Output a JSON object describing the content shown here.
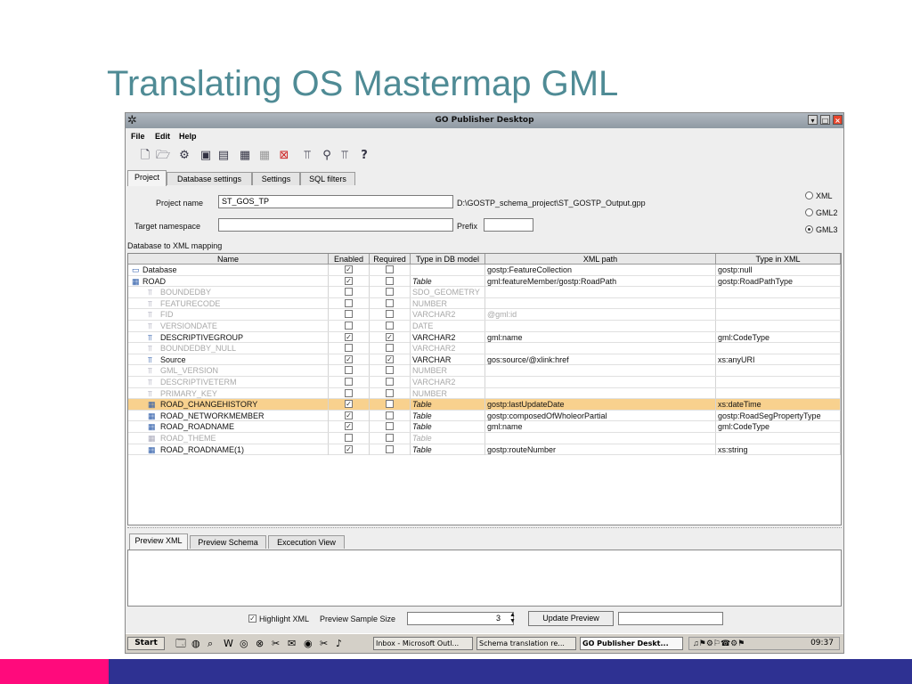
{
  "slide": {
    "title": "Translating OS Mastermap GML"
  },
  "window": {
    "title": "GO Publisher Desktop",
    "app_icon": "gear-star-icon"
  },
  "menu": {
    "file": "File",
    "edit": "Edit",
    "help": "Help"
  },
  "toolbar_icons": [
    "new-document-icon",
    "open-folder-icon",
    "gear-icon",
    "save-icon",
    "save-all-icon",
    "table-icon",
    "grey-table-icon",
    "delete-table-icon",
    "mapping-icon",
    "schema-icon",
    "mapping-wizard-icon",
    "help-icon"
  ],
  "tabs": [
    "Project",
    "Database settings",
    "Settings",
    "SQL filters"
  ],
  "project": {
    "name_label": "Project name",
    "name_value": "ST_GOS_TP",
    "path": "D:\\GOSTP_schema_project\\ST_GOSTP_Output.gpp",
    "namespace_label": "Target namespace",
    "namespace_value": "",
    "prefix_label": "Prefix",
    "prefix_value": "",
    "formats": [
      "XML",
      "GML2",
      "GML3"
    ],
    "selected_format": "GML3"
  },
  "mapping": {
    "label": "Database to XML mapping",
    "columns": [
      "Name",
      "Enabled",
      "Required",
      "Type in DB model",
      "XML path",
      "Type in XML"
    ],
    "rows": [
      {
        "name": "Database",
        "enabled": true,
        "required": false,
        "dbtype": "",
        "xmlpath": "gostp:FeatureCollection",
        "xmltype": "gostp:null",
        "level": 0,
        "dim": false
      },
      {
        "name": "ROAD",
        "enabled": true,
        "required": false,
        "dbtype": "Table",
        "xmlpath": "gml:featureMember/gostp:RoadPath",
        "xmltype": "gostp:RoadPathType",
        "level": 0,
        "dim": false
      },
      {
        "name": "BOUNDEDBY",
        "enabled": false,
        "required": false,
        "dbtype": "SDO_GEOMETRY",
        "xmlpath": "",
        "xmltype": "",
        "level": 1,
        "dim": true
      },
      {
        "name": "FEATURECODE",
        "enabled": false,
        "required": false,
        "dbtype": "NUMBER",
        "xmlpath": "",
        "xmltype": "",
        "level": 1,
        "dim": true
      },
      {
        "name": "FID",
        "enabled": false,
        "required": false,
        "dbtype": "VARCHAR2",
        "xmlpath": "@gml:id",
        "xmltype": "",
        "level": 1,
        "dim": true
      },
      {
        "name": "VERSIONDATE",
        "enabled": false,
        "required": false,
        "dbtype": "DATE",
        "xmlpath": "",
        "xmltype": "",
        "level": 1,
        "dim": true
      },
      {
        "name": "DESCRIPTIVEGROUP",
        "enabled": true,
        "required": true,
        "dbtype": "VARCHAR2",
        "xmlpath": "gml:name",
        "xmltype": "gml:CodeType",
        "level": 1,
        "dim": false
      },
      {
        "name": "BOUNDEDBY_NULL",
        "enabled": false,
        "required": false,
        "dbtype": "VARCHAR2",
        "xmlpath": "",
        "xmltype": "",
        "level": 1,
        "dim": true
      },
      {
        "name": "Source",
        "enabled": true,
        "required": true,
        "dbtype": "VARCHAR",
        "xmlpath": "gos:source/@xlink:href",
        "xmltype": "xs:anyURI",
        "level": 1,
        "dim": false
      },
      {
        "name": "GML_VERSION",
        "enabled": false,
        "required": false,
        "dbtype": "NUMBER",
        "xmlpath": "",
        "xmltype": "",
        "level": 1,
        "dim": true
      },
      {
        "name": "DESCRIPTIVETERM",
        "enabled": false,
        "required": false,
        "dbtype": "VARCHAR2",
        "xmlpath": "",
        "xmltype": "",
        "level": 1,
        "dim": true
      },
      {
        "name": "PRIMARY_KEY",
        "enabled": false,
        "required": false,
        "dbtype": "NUMBER",
        "xmlpath": "",
        "xmltype": "",
        "level": 1,
        "dim": true
      },
      {
        "name": "ROAD_CHANGEHISTORY",
        "enabled": true,
        "required": false,
        "dbtype": "Table",
        "xmlpath": "gostp:lastUpdateDate",
        "xmltype": "xs:dateTime",
        "level": 1,
        "dim": false,
        "selected": true
      },
      {
        "name": "ROAD_NETWORKMEMBER",
        "enabled": true,
        "required": false,
        "dbtype": "Table",
        "xmlpath": "gostp:composedOfWholeorPartial",
        "xmltype": "gostp:RoadSegPropertyType",
        "level": 1,
        "dim": false
      },
      {
        "name": "ROAD_ROADNAME",
        "enabled": true,
        "required": false,
        "dbtype": "Table",
        "xmlpath": "gml:name",
        "xmltype": "gml:CodeType",
        "level": 1,
        "dim": false
      },
      {
        "name": "ROAD_THEME",
        "enabled": false,
        "required": false,
        "dbtype": "Table",
        "xmlpath": "",
        "xmltype": "",
        "level": 1,
        "dim": true
      },
      {
        "name": "ROAD_ROADNAME(1)",
        "enabled": true,
        "required": false,
        "dbtype": "Table",
        "xmlpath": "gostp:routeNumber",
        "xmltype": "xs:string",
        "level": 1,
        "dim": false
      }
    ]
  },
  "preview_tabs": [
    "Preview XML",
    "Preview Schema",
    "Excecution View"
  ],
  "bottom": {
    "highlight_label": "Highlight XML",
    "highlight_checked": true,
    "sample_label": "Preview Sample Size",
    "sample_value": "3",
    "update_button": "Update Preview"
  },
  "taskbar": {
    "start": "Start",
    "tasks": [
      "Inbox - Microsoft Outl...",
      "Schema translation re...",
      "GO Publisher Deskt..."
    ],
    "active_task": 2,
    "clock": "09:37"
  },
  "colors": {
    "title": "#4f8b95",
    "selection": "#f8d18e",
    "accent_pink": "#ff0a7c",
    "accent_blue": "#2e3192"
  }
}
